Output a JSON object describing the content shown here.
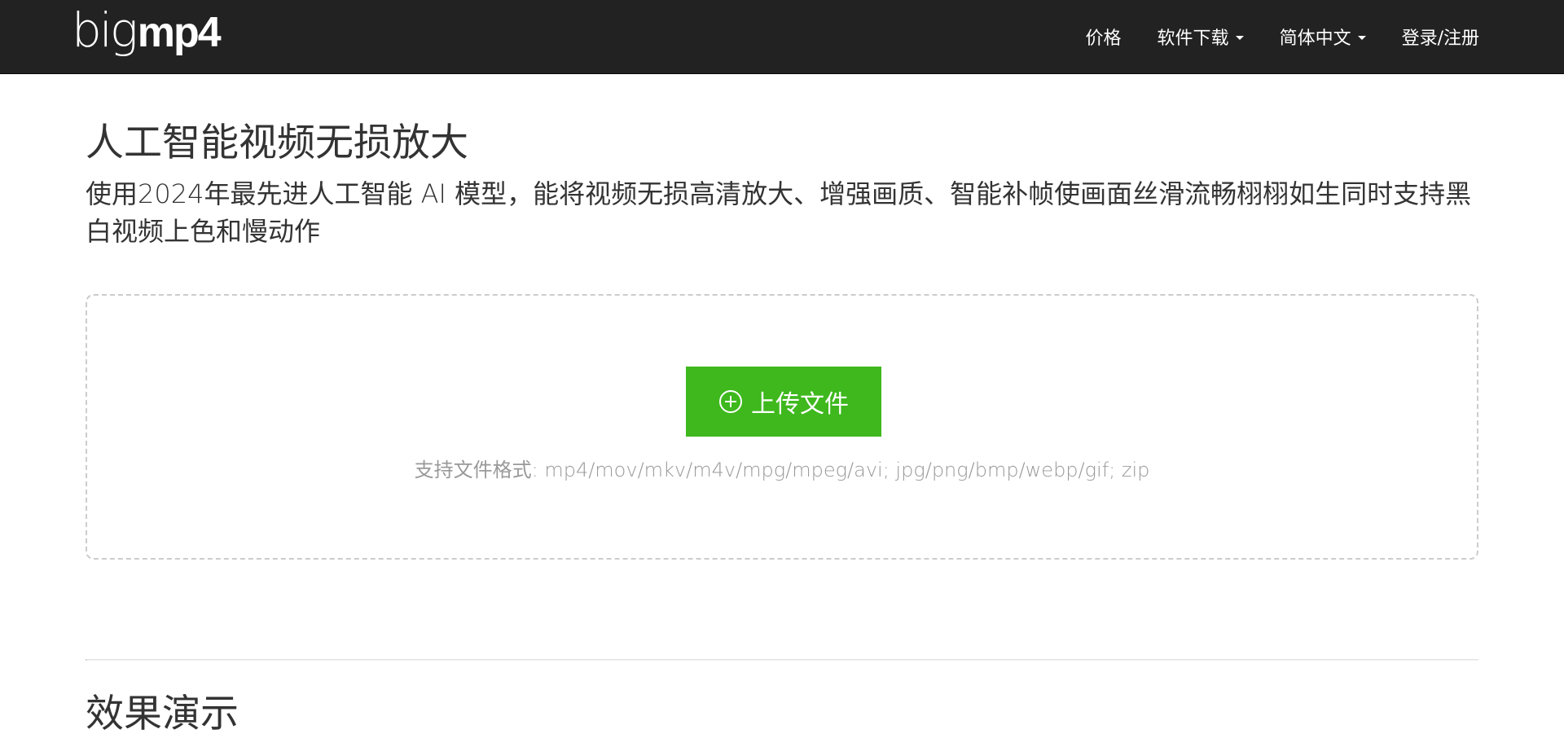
{
  "navbar": {
    "logo": {
      "part1": "big",
      "part2": "mp4"
    },
    "items": [
      {
        "label": "价格",
        "dropdown": false
      },
      {
        "label": "软件下载",
        "dropdown": true
      },
      {
        "label": "简体中文",
        "dropdown": true
      },
      {
        "label": "登录/注册",
        "dropdown": false
      }
    ]
  },
  "hero": {
    "title": "人工智能视频无损放大",
    "description": "使用2024年最先进人工智能 AI 模型，能将视频无损高清放大、增强画质、智能补帧使画面丝滑流畅栩栩如生同时支持黑白视频上色和慢动作"
  },
  "upload": {
    "button_label": "上传文件",
    "icon": "plus-circle-icon",
    "formats": "支持文件格式: mp4/mov/mkv/m4v/mpg/mpeg/avi; jpg/png/bmp/webp/gif; zip"
  },
  "demo": {
    "title": "效果演示"
  },
  "colors": {
    "navbar_bg": "#222222",
    "accent_green": "#3eb81d",
    "text": "#333333",
    "muted": "#999999"
  }
}
